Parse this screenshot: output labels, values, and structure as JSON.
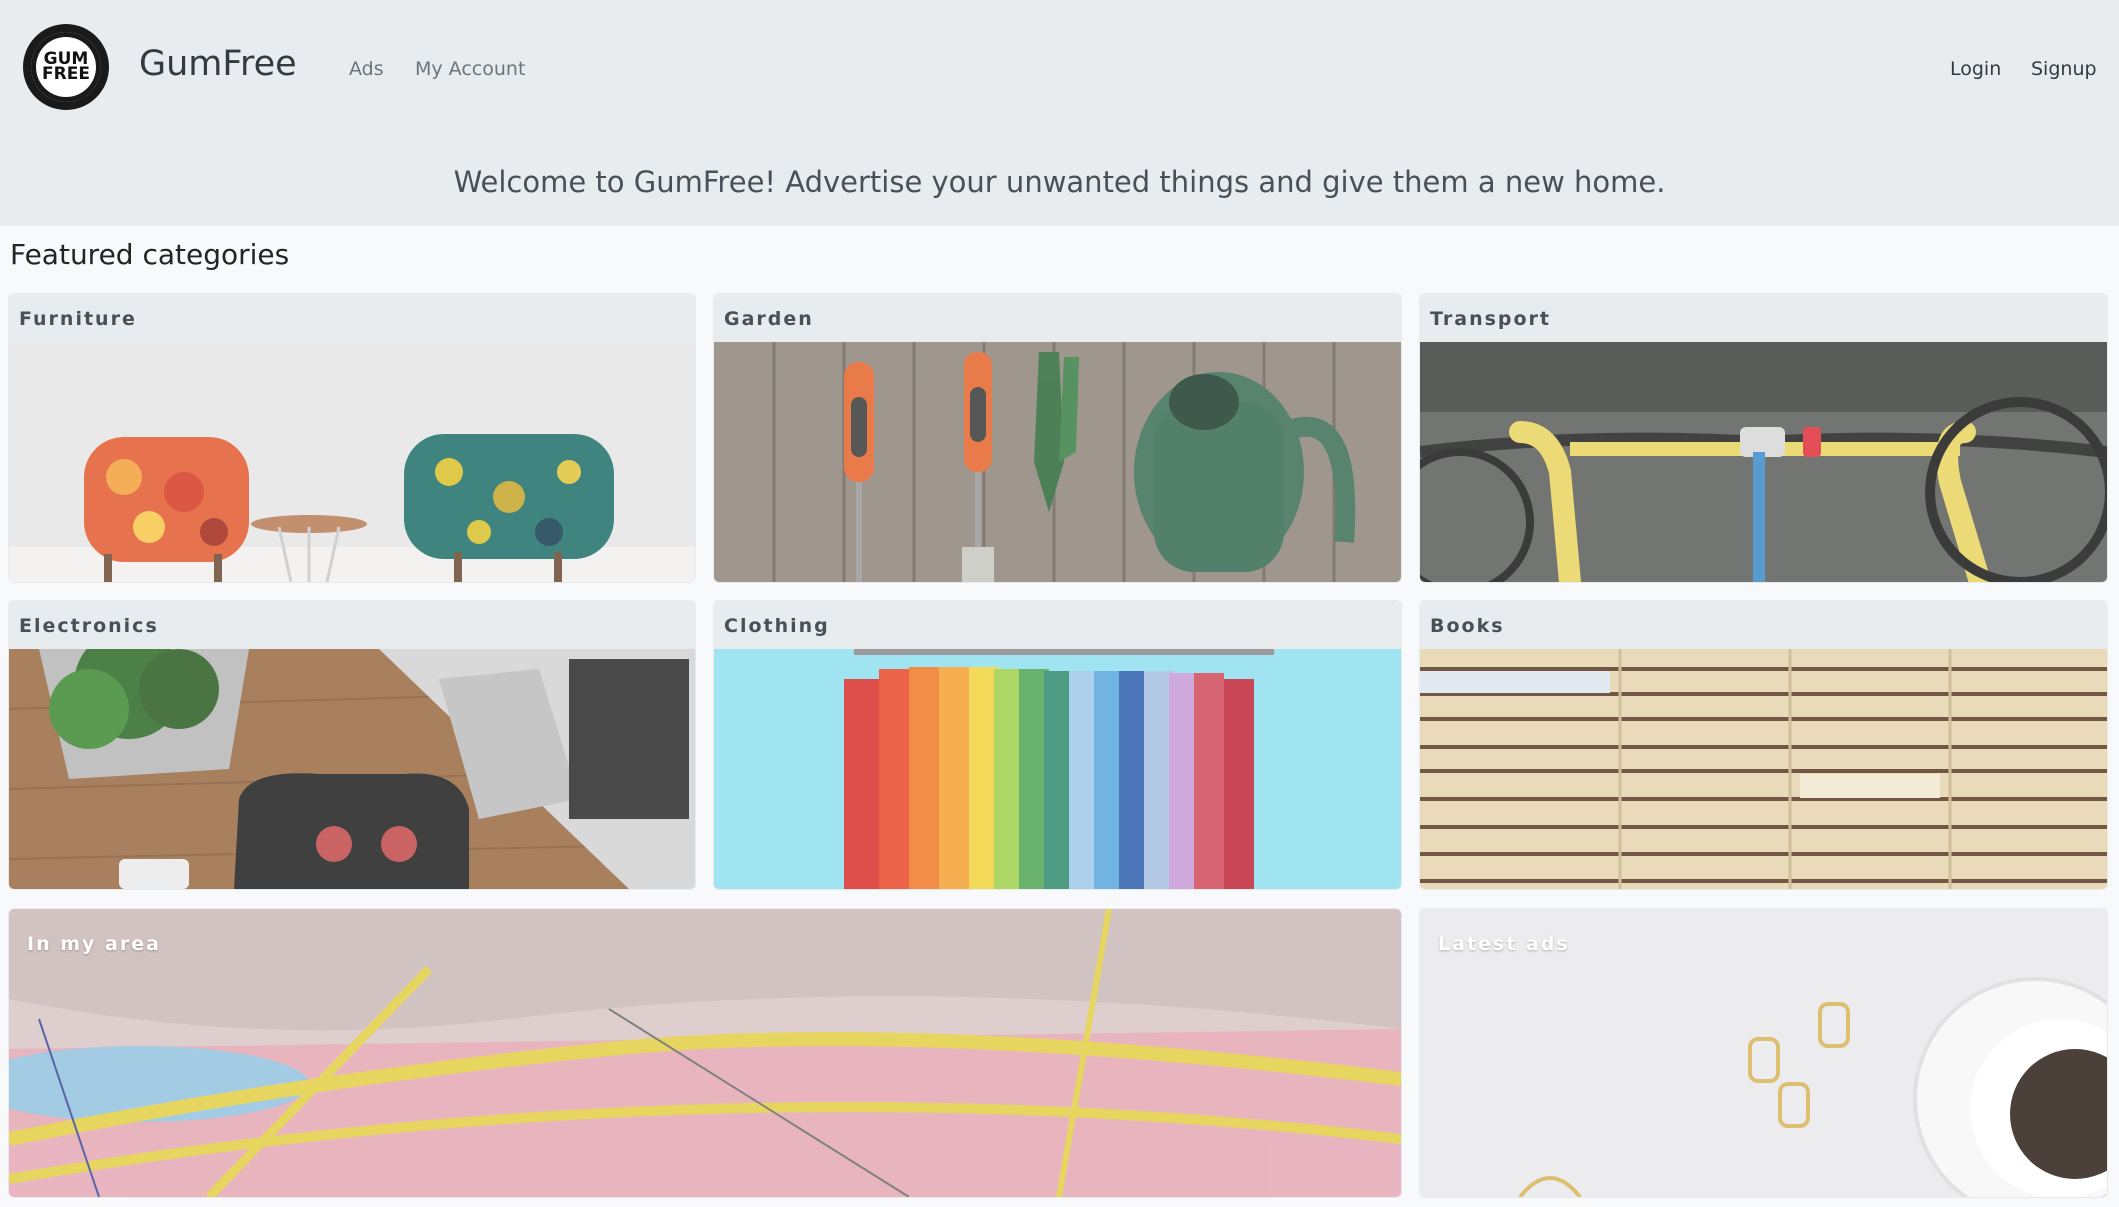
{
  "header": {
    "brand": "GumFree",
    "logo_text_top": "GUM",
    "logo_text_bottom": "FREE",
    "nav": {
      "ads": "Ads",
      "account": "My Account",
      "login": "Login",
      "signup": "Signup"
    },
    "welcome": "Welcome to GumFree! Advertise your unwanted things and give them a new home."
  },
  "featured": {
    "title": "Featured categories",
    "categories": [
      {
        "label": "Furniture",
        "image": "chairs-photo"
      },
      {
        "label": "Garden",
        "image": "garden-tools-photo"
      },
      {
        "label": "Transport",
        "image": "bicycles-photo"
      },
      {
        "label": "Electronics",
        "image": "laptop-controller-photo"
      },
      {
        "label": "Clothing",
        "image": "clothes-rack-photo"
      },
      {
        "label": "Books",
        "image": "book-stacks-photo"
      }
    ],
    "wide_cards": [
      {
        "label": "In my area",
        "image": "map-photo"
      },
      {
        "label": "Latest ads",
        "image": "coffee-desk-photo"
      }
    ]
  },
  "colors": {
    "header_bg": "#e9ecef",
    "page_bg": "#f8f9fa",
    "nav_muted": "#6c757d",
    "text_dark": "#343a40"
  }
}
